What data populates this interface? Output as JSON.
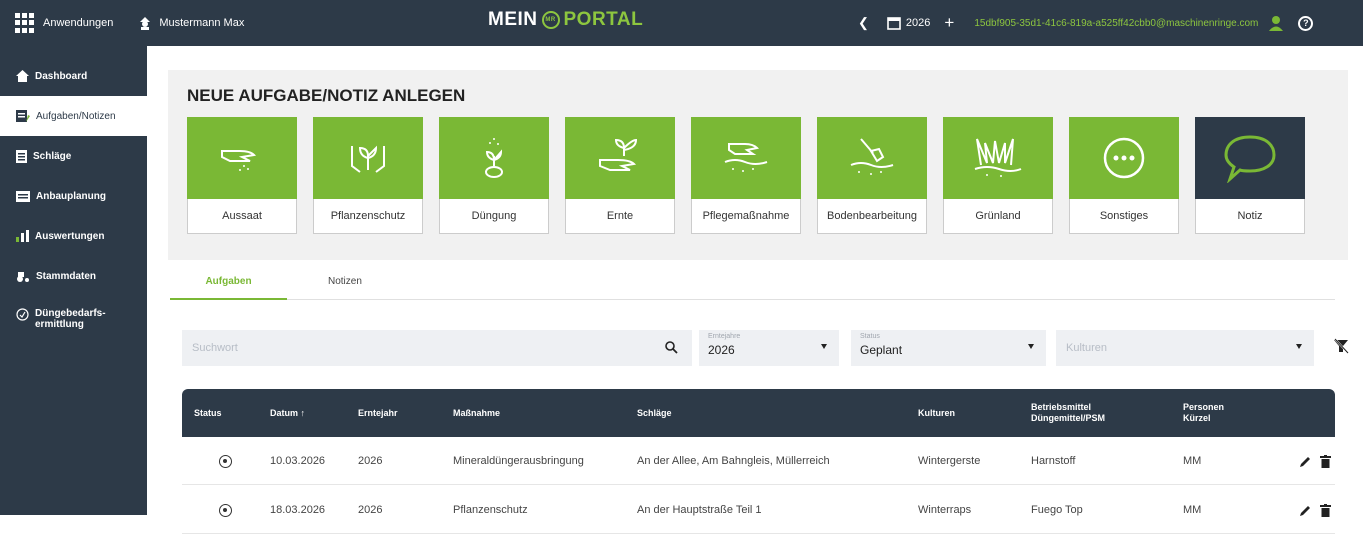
{
  "topbar": {
    "apps_label": "Anwendungen",
    "user_name": "Mustermann Max",
    "logo_left": "MEIN",
    "logo_badge": "MR",
    "logo_right": "PORTAL",
    "year": "2026",
    "email": "15dbf905-35d1-41c6-819a-a525ff42cbb0@maschinenringe.com"
  },
  "sidebar": {
    "items": [
      {
        "label": "Dashboard"
      },
      {
        "label": "Aufgaben/Notizen"
      },
      {
        "label": "Schläge"
      },
      {
        "label": "Anbauplanung"
      },
      {
        "label": "Auswertungen"
      },
      {
        "label": "Stammdaten"
      },
      {
        "label": "Düngebedarfs-",
        "label2": "ermittlung"
      }
    ]
  },
  "panel": {
    "title": "NEUE AUFGABE/NOTIZ ANLEGEN",
    "tiles": [
      {
        "label": "Aussaat",
        "icon": "sowing-hand-icon"
      },
      {
        "label": "Pflanzenschutz",
        "icon": "hands-plant-icon"
      },
      {
        "label": "Düngung",
        "icon": "sprout-fertilizer-icon"
      },
      {
        "label": "Ernte",
        "icon": "hand-sprout-icon"
      },
      {
        "label": "Pflegemaßnahme",
        "icon": "hand-soil-icon"
      },
      {
        "label": "Bodenbearbeitung",
        "icon": "shovel-soil-icon"
      },
      {
        "label": "Grünland",
        "icon": "grass-icon"
      },
      {
        "label": "Sonstiges",
        "icon": "more-dots-icon"
      },
      {
        "label": "Notiz",
        "icon": "speech-bubble-icon"
      }
    ]
  },
  "tabs": {
    "tasks": "Aufgaben",
    "notes": "Notizen"
  },
  "filters": {
    "search_placeholder": "Suchwort",
    "year_label": "Erntejahre",
    "year_value": "2026",
    "status_label": "Status",
    "status_value": "Geplant",
    "crops_placeholder": "Kulturen"
  },
  "table": {
    "headers": {
      "status": "Status",
      "date": "Datum ↑",
      "year": "Erntejahr",
      "measure": "Maßnahme",
      "fields": "Schläge",
      "crops": "Kulturen",
      "means1": "Betriebsmittel",
      "means2": "Düngemittel/PSM",
      "persons1": "Personen",
      "persons2": "Kürzel"
    },
    "rows": [
      {
        "date": "10.03.2026",
        "year": "2026",
        "measure": "Mineraldüngerausbringung",
        "fields": "An der Allee, Am Bahngleis, Müllerreich",
        "crops": "Wintergerste",
        "means": "Harnstoff",
        "persons": "MM"
      },
      {
        "date": "18.03.2026",
        "year": "2026",
        "measure": "Pflanzenschutz",
        "fields": "An der Hauptstraße Teil 1",
        "crops": "Winterraps",
        "means": "Fuego Top",
        "persons": "MM"
      }
    ]
  },
  "colors": {
    "brand_dark": "#2d3a48",
    "brand_green": "#7ab835"
  }
}
